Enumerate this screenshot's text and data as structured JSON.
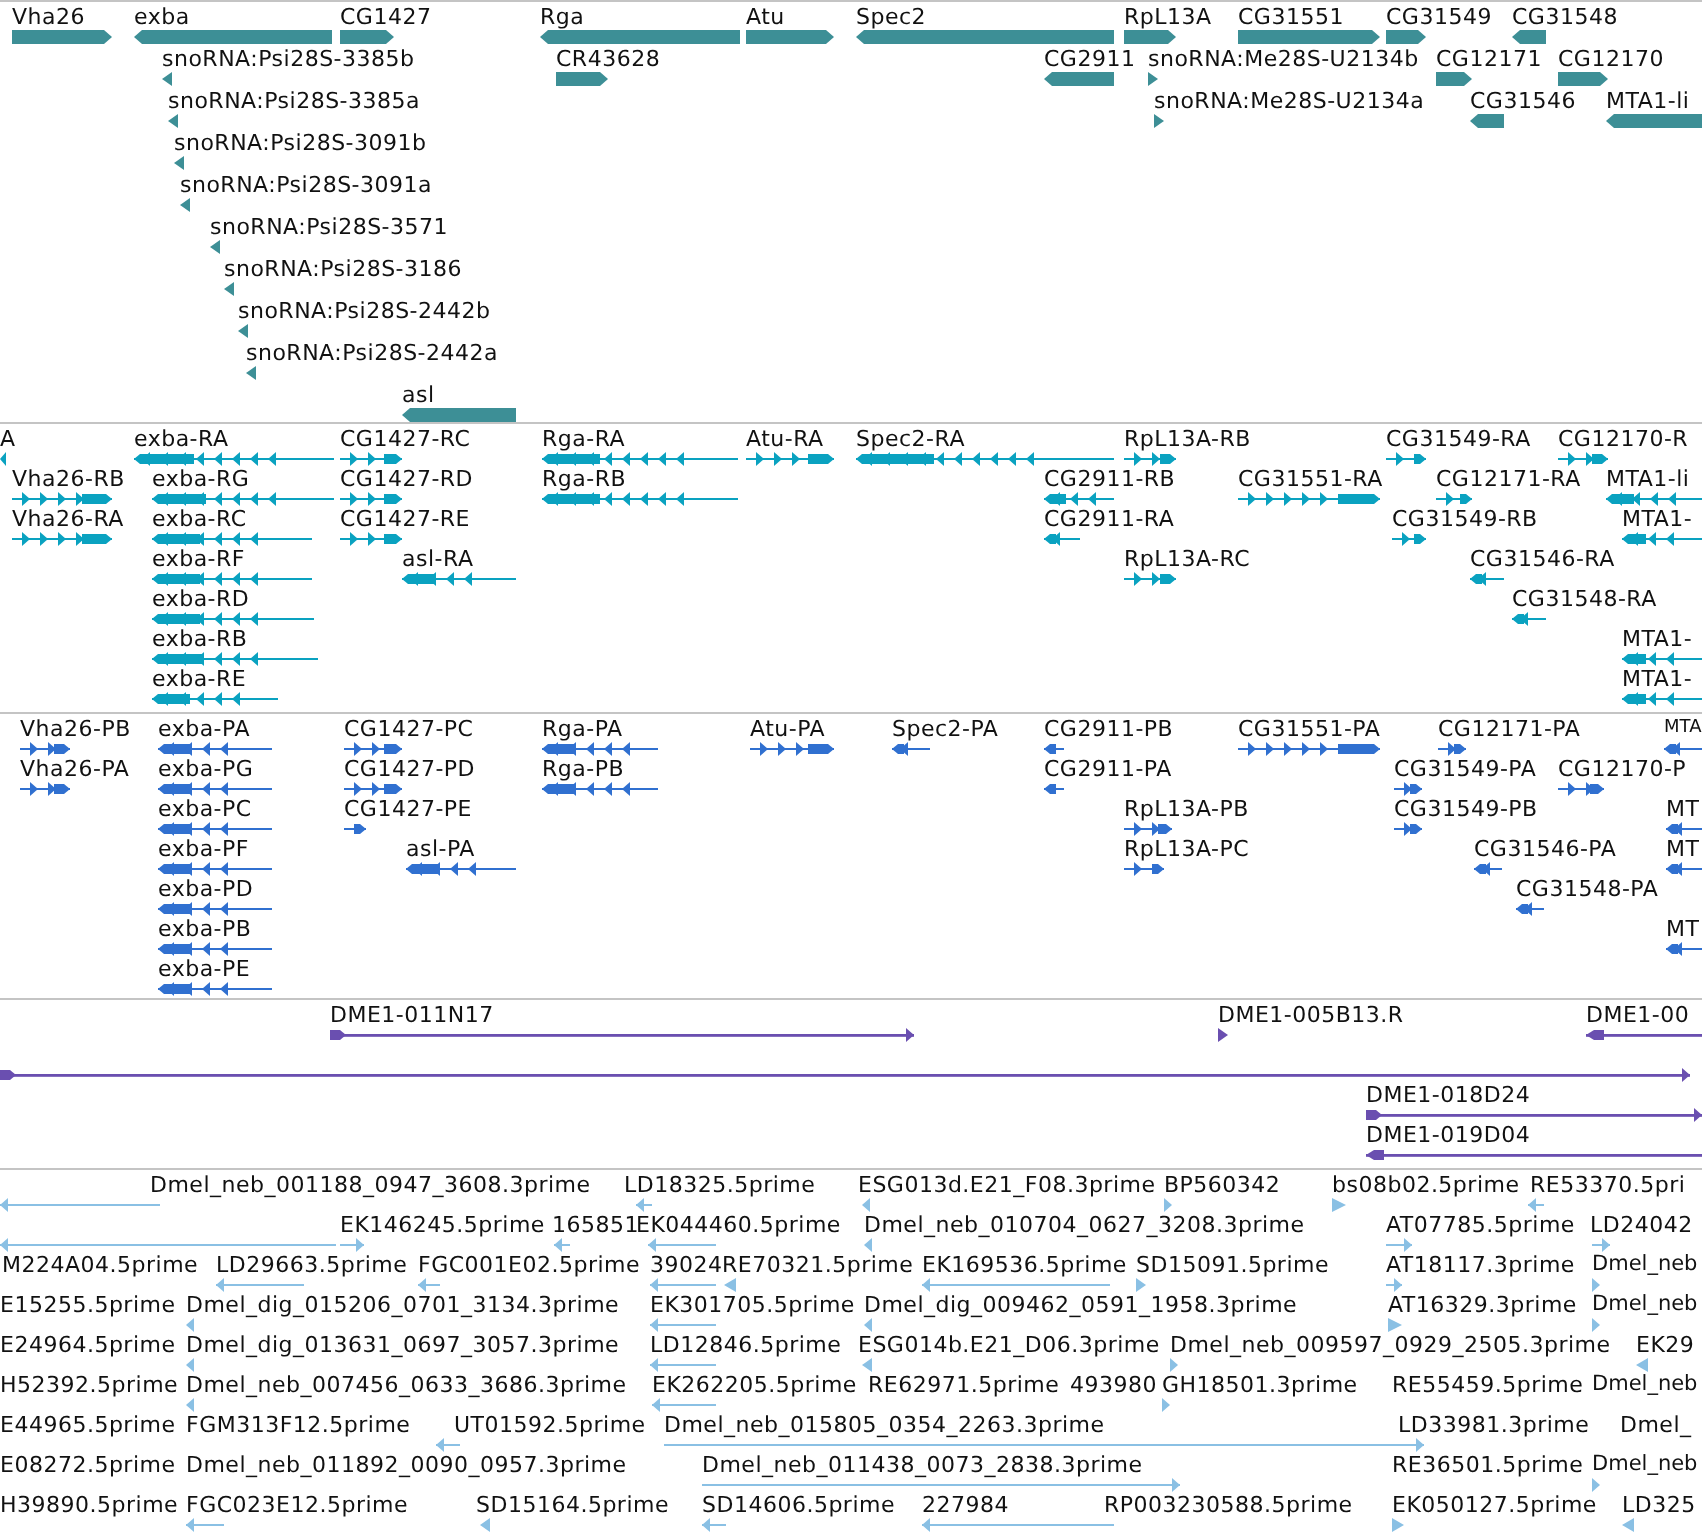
{
  "tracks": [
    {
      "kind": "gene",
      "features": [
        {
          "label": "Vha26",
          "reverse": false
        },
        {
          "label": "exba",
          "reverse": true
        },
        {
          "label": "CG1427",
          "reverse": false
        },
        {
          "label": "Rga",
          "reverse": true
        },
        {
          "label": "Atu",
          "reverse": false
        },
        {
          "label": "Spec2",
          "reverse": true
        },
        {
          "label": "RpL13A",
          "reverse": false
        },
        {
          "label": "CG31551",
          "reverse": false
        },
        {
          "label": "CG31549",
          "reverse": false
        },
        {
          "label": "CG31548",
          "reverse": true
        },
        {
          "label": "snoRNA:Psi28S-3385b",
          "reverse": true
        },
        {
          "label": "CR43628",
          "reverse": false
        },
        {
          "label": "CG2911",
          "reverse": true
        },
        {
          "label": "snoRNA:Me28S-U2134b",
          "reverse": false
        },
        {
          "label": "CG12171",
          "reverse": false
        },
        {
          "label": "CG12170",
          "reverse": false
        },
        {
          "label": "snoRNA:Psi28S-3385a",
          "reverse": true
        },
        {
          "label": "snoRNA:Me28S-U2134a",
          "reverse": false
        },
        {
          "label": "CG31546",
          "reverse": true
        },
        {
          "label": "MTA1-li",
          "reverse": true
        },
        {
          "label": "snoRNA:Psi28S-3091b",
          "reverse": true
        },
        {
          "label": "snoRNA:Psi28S-3091a",
          "reverse": true
        },
        {
          "label": "snoRNA:Psi28S-3571",
          "reverse": true
        },
        {
          "label": "snoRNA:Psi28S-3186",
          "reverse": true
        },
        {
          "label": "snoRNA:Psi28S-2442b",
          "reverse": true
        },
        {
          "label": "snoRNA:Psi28S-2442a",
          "reverse": true
        },
        {
          "label": "asl",
          "reverse": true
        }
      ]
    },
    {
      "kind": "transcript",
      "features": [
        {
          "label": "A",
          "reverse": true
        },
        {
          "label": "exba-RA",
          "reverse": true
        },
        {
          "label": "CG1427-RC",
          "reverse": false
        },
        {
          "label": "Rga-RA",
          "reverse": true
        },
        {
          "label": "Atu-RA",
          "reverse": false
        },
        {
          "label": "Spec2-RA",
          "reverse": true
        },
        {
          "label": "RpL13A-RB",
          "reverse": false
        },
        {
          "label": "CG31549-RA",
          "reverse": false
        },
        {
          "label": "CG12170-R",
          "reverse": false
        },
        {
          "label": "Vha26-RB",
          "reverse": false
        },
        {
          "label": "exba-RG",
          "reverse": true
        },
        {
          "label": "CG1427-RD",
          "reverse": false
        },
        {
          "label": "Rga-RB",
          "reverse": true
        },
        {
          "label": "CG2911-RB",
          "reverse": true
        },
        {
          "label": "CG31551-RA",
          "reverse": false
        },
        {
          "label": "CG12171-RA",
          "reverse": false
        },
        {
          "label": "MTA1-li",
          "reverse": true
        },
        {
          "label": "Vha26-RA",
          "reverse": false
        },
        {
          "label": "exba-RC",
          "reverse": true
        },
        {
          "label": "CG1427-RE",
          "reverse": false
        },
        {
          "label": "CG2911-RA",
          "reverse": true
        },
        {
          "label": "CG31549-RB",
          "reverse": false
        },
        {
          "label": "MTA1-",
          "reverse": true
        },
        {
          "label": "exba-RF",
          "reverse": true
        },
        {
          "label": "asl-RA",
          "reverse": true
        },
        {
          "label": "RpL13A-RC",
          "reverse": false
        },
        {
          "label": "CG31546-RA",
          "reverse": true
        },
        {
          "label": "exba-RD",
          "reverse": true
        },
        {
          "label": "CG31548-RA",
          "reverse": true
        },
        {
          "label": "exba-RB",
          "reverse": true
        },
        {
          "label": "MTA1-",
          "reverse": true
        },
        {
          "label": "exba-RE",
          "reverse": true
        },
        {
          "label": "MTA1-",
          "reverse": true
        }
      ]
    },
    {
      "kind": "protein",
      "features": [
        {
          "label": "Vha26-PB",
          "reverse": false
        },
        {
          "label": "exba-PA",
          "reverse": true
        },
        {
          "label": "CG1427-PC",
          "reverse": false
        },
        {
          "label": "Rga-PA",
          "reverse": true
        },
        {
          "label": "Atu-PA",
          "reverse": false
        },
        {
          "label": "Spec2-PA",
          "reverse": true
        },
        {
          "label": "CG2911-PB",
          "reverse": true
        },
        {
          "label": "CG31551-PA",
          "reverse": false
        },
        {
          "label": "CG12171-PA",
          "reverse": false
        },
        {
          "label": "MTA",
          "reverse": true
        },
        {
          "label": "Vha26-PA",
          "reverse": false
        },
        {
          "label": "exba-PG",
          "reverse": true
        },
        {
          "label": "CG1427-PD",
          "reverse": false
        },
        {
          "label": "Rga-PB",
          "reverse": true
        },
        {
          "label": "CG2911-PA",
          "reverse": true
        },
        {
          "label": "CG31549-PA",
          "reverse": false
        },
        {
          "label": "CG12170-P",
          "reverse": false
        },
        {
          "label": "exba-PC",
          "reverse": true
        },
        {
          "label": "CG1427-PE",
          "reverse": false
        },
        {
          "label": "RpL13A-PB",
          "reverse": false
        },
        {
          "label": "CG31549-PB",
          "reverse": false
        },
        {
          "label": "MT",
          "reverse": true
        },
        {
          "label": "exba-PF",
          "reverse": true
        },
        {
          "label": "asl-PA",
          "reverse": true
        },
        {
          "label": "RpL13A-PC",
          "reverse": false
        },
        {
          "label": "CG31546-PA",
          "reverse": true
        },
        {
          "label": "MT",
          "reverse": true
        },
        {
          "label": "exba-PD",
          "reverse": true
        },
        {
          "label": "CG31548-PA",
          "reverse": true
        },
        {
          "label": "exba-PB",
          "reverse": true
        },
        {
          "label": "MT",
          "reverse": true
        },
        {
          "label": "exba-PE",
          "reverse": true
        }
      ]
    },
    {
      "kind": "clone",
      "features": [
        {
          "label": "DME1-011N17",
          "reverse": false
        },
        {
          "label": "DME1-005B13.R",
          "reverse": false
        },
        {
          "label": "DME1-00",
          "reverse": true
        },
        {
          "reverse": false
        },
        {
          "label": "DME1-018D24",
          "reverse": false
        },
        {
          "label": "DME1-019D04",
          "reverse": true
        }
      ]
    },
    {
      "kind": "est",
      "features": [
        {
          "label": "Dmel_neb_001188_0947_3608.3prime",
          "reverse": true
        },
        {
          "label": "LD18325.5prime",
          "reverse": true
        },
        {
          "label": "ESG013d.E21_F08.3prime",
          "reverse": true
        },
        {
          "label": "BP560342",
          "reverse": false
        },
        {
          "label": "bs08b02.5prime",
          "reverse": false
        },
        {
          "label": "RE53370.5pri",
          "reverse": true
        },
        {
          "reverse": true
        },
        {
          "label": "EK146245.5prime",
          "reverse": false
        },
        {
          "label": "165851",
          "reverse": true
        },
        {
          "label": "EK044460.5prime",
          "reverse": true
        },
        {
          "label": "Dmel_neb_010704_0627_3208.3prime",
          "reverse": true
        },
        {
          "label": "AT07785.5prime",
          "reverse": false
        },
        {
          "label": "LD24042",
          "reverse": false
        },
        {
          "label": "M224A04.5prime"
        },
        {
          "label": "LD29663.5prime",
          "reverse": true
        },
        {
          "label": "FGC001E02.5prime",
          "reverse": true
        },
        {
          "label": "39024",
          "reverse": true
        },
        {
          "label": "RE70321.5prime",
          "reverse": true
        },
        {
          "label": "EK169536.5prime",
          "reverse": true
        },
        {
          "label": "SD15091.5prime",
          "reverse": false
        },
        {
          "label": "AT18117.3prime",
          "reverse": false
        },
        {
          "label": "Dmel_neb",
          "reverse": false
        },
        {
          "label": "E15255.5prime"
        },
        {
          "label": "Dmel_dig_015206_0701_3134.3prime",
          "reverse": true
        },
        {
          "label": "EK301705.5prime",
          "reverse": true
        },
        {
          "label": "Dmel_dig_009462_0591_1958.3prime",
          "reverse": true
        },
        {
          "label": "AT16329.3prime",
          "reverse": false
        },
        {
          "label": "Dmel_neb",
          "reverse": false
        },
        {
          "label": "E24964.5prime"
        },
        {
          "label": "Dmel_dig_013631_0697_3057.3prime",
          "reverse": true
        },
        {
          "label": "LD12846.5prime",
          "reverse": true
        },
        {
          "label": "ESG014b.E21_D06.3prime",
          "reverse": true
        },
        {
          "label": "Dmel_neb_009597_0929_2505.3prime",
          "reverse": false
        },
        {
          "label": "EK29",
          "reverse": true
        },
        {
          "label": "H52392.5prime"
        },
        {
          "label": "Dmel_neb_007456_0633_3686.3prime",
          "reverse": true
        },
        {
          "label": "EK262205.5prime",
          "reverse": true
        },
        {
          "label": "RE62971.5prime"
        },
        {
          "label": "493980"
        },
        {
          "label": "GH18501.3prime",
          "reverse": false
        },
        {
          "label": "RE55459.5prime"
        },
        {
          "label": "Dmel_neb"
        },
        {
          "label": "E44965.5prime"
        },
        {
          "label": "FGM313F12.5prime"
        },
        {
          "label": "UT01592.5prime",
          "reverse": true
        },
        {
          "label": "Dmel_neb_015805_0354_2263.3prime",
          "reverse": false
        },
        {
          "label": "LD33981.3prime"
        },
        {
          "label": "Dmel_"
        },
        {
          "label": "E08272.5prime"
        },
        {
          "label": "Dmel_neb_011892_0090_0957.3prime"
        },
        {
          "label": "Dmel_neb_011438_0073_2838.3prime",
          "reverse": false
        },
        {
          "label": "RE36501.5prime"
        },
        {
          "label": "Dmel_neb",
          "reverse": false
        },
        {
          "label": "H39890.5prime"
        },
        {
          "label": "FGC023E12.5prime",
          "reverse": true
        },
        {
          "label": "SD15164.5prime",
          "reverse": true
        },
        {
          "label": "SD14606.5prime",
          "reverse": true
        },
        {
          "label": "227984",
          "reverse": true
        },
        {
          "label": "RP003230588.5prime"
        },
        {
          "label": "EK050127.5prime",
          "reverse": false
        },
        {
          "label": "LD325",
          "reverse": true
        }
      ]
    }
  ]
}
